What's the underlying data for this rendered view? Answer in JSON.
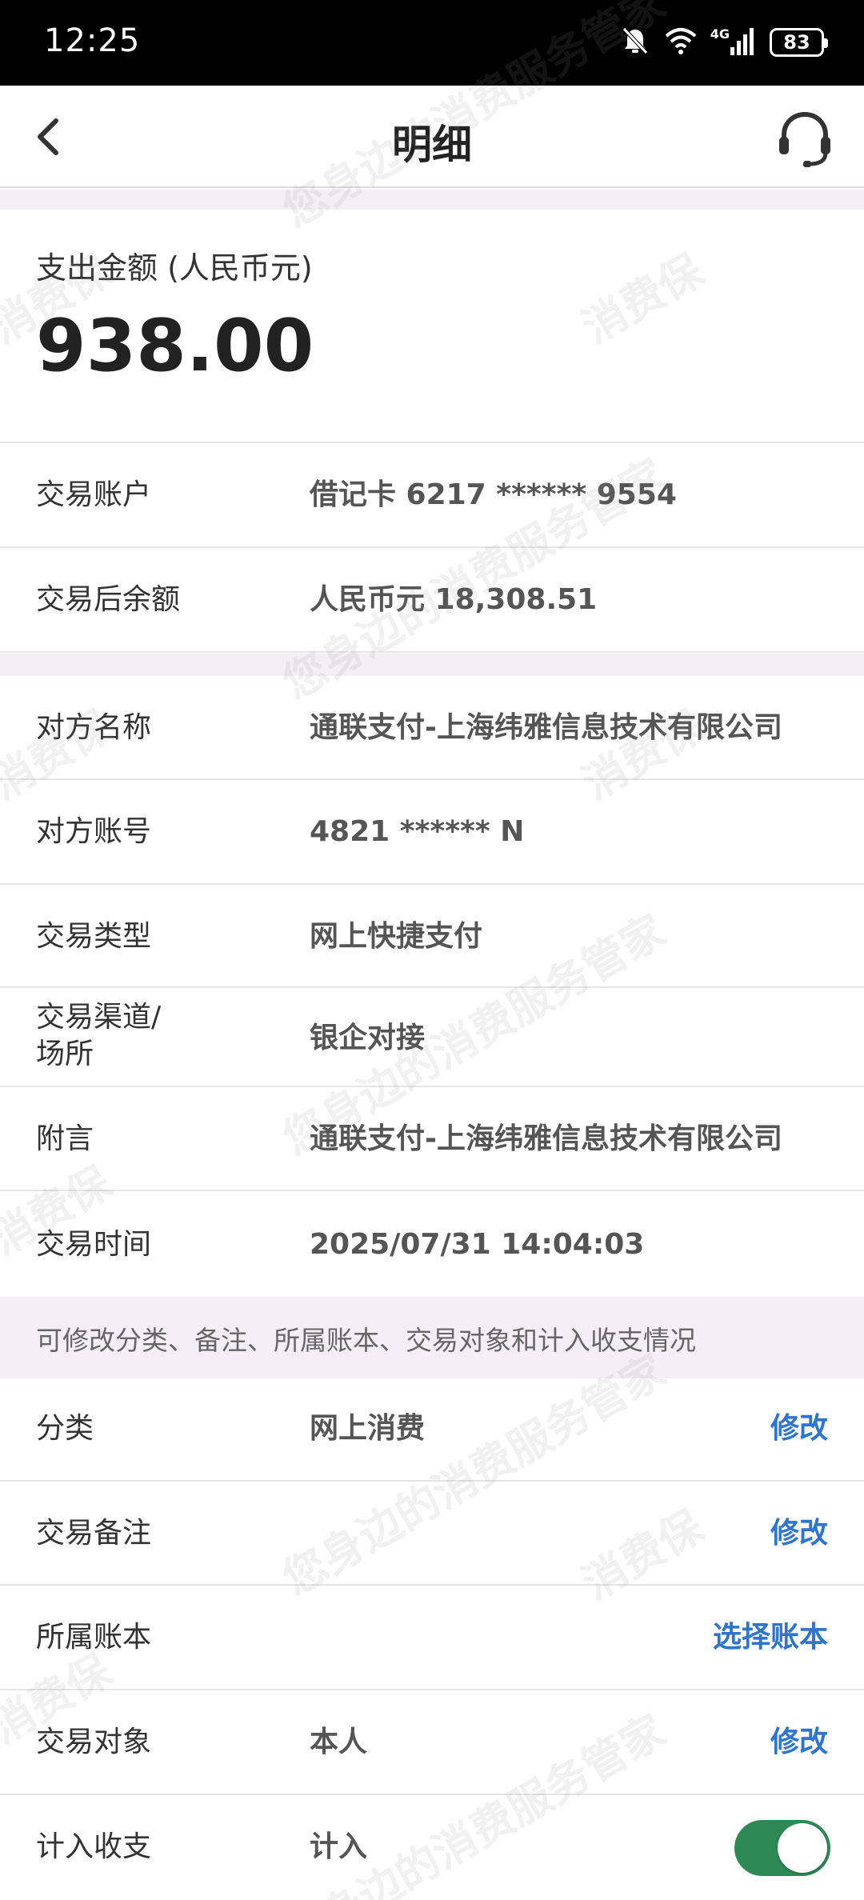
{
  "status_bar": {
    "time": "12:25",
    "network_type": "4G",
    "battery_level": "83",
    "icons": [
      "bell-muted-icon",
      "wifi-icon",
      "signal-icon",
      "battery-icon"
    ]
  },
  "header": {
    "title": "明细",
    "back_icon": "chevron-left-icon",
    "support_icon": "headset-icon"
  },
  "amount": {
    "label": "支出金额 (人民币元)",
    "value": "938.00"
  },
  "account_section": [
    {
      "label": "交易账户",
      "value": "借记卡 6217 ****** 9554"
    },
    {
      "label": "交易后余额",
      "value": "人民币元 18,308.51"
    }
  ],
  "detail_section": [
    {
      "label": "对方名称",
      "value": "通联支付-上海纬雅信息技术有限公司"
    },
    {
      "label": "对方账号",
      "value": "4821 ****** N"
    },
    {
      "label": "交易类型",
      "value": "网上快捷支付"
    },
    {
      "label": "交易渠道/场所",
      "label_line1": "交易渠道/",
      "label_line2": "场所",
      "value": "银企对接"
    },
    {
      "label": "附言",
      "value": "通联支付-上海纬雅信息技术有限公司"
    },
    {
      "label": "交易时间",
      "value": "2025/07/31 14:04:03"
    }
  ],
  "hint": "可修改分类、备注、所属账本、交易对象和计入收支情况",
  "editable_section": [
    {
      "label": "分类",
      "value": "网上消费",
      "action": "修改"
    },
    {
      "label": "交易备注",
      "value": "",
      "action": "修改"
    },
    {
      "label": "所属账本",
      "value": "",
      "action": "选择账本"
    },
    {
      "label": "交易对象",
      "value": "本人",
      "action": "修改"
    },
    {
      "label": "计入收支",
      "value": "计入",
      "toggle_on": true
    }
  ],
  "watermark_text": "您身边的消费服务管家",
  "watermark_text_2": "消费保",
  "colors": {
    "accent_link": "#2f74d0",
    "toggle_on": "#2e8a55",
    "band": "#f4eff6"
  }
}
